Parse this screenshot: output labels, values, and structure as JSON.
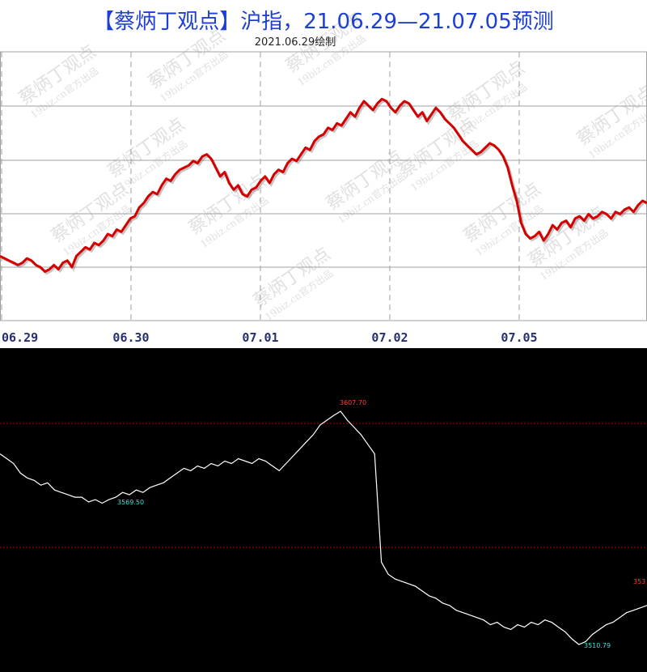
{
  "top_chart": {
    "title": "【蔡炳丁观点】沪指，21.06.29—21.07.05预测",
    "subtitle": "2021.06.29绘制",
    "watermark_text": "蔡炳丁观点",
    "watermark_sub": "19biz.cn官方出品",
    "colors": {
      "line": "#d40000",
      "grid": "#a0a0a0",
      "title": "#1d3fd6",
      "tick": "#26306e"
    }
  },
  "bottom_chart": {
    "high_label": "3607.70",
    "low1_label": "3569.50",
    "low2_label": "3510.79",
    "right_label": "353",
    "colors": {
      "line": "#ffffff",
      "high": "#ff4040",
      "low": "#40e0e0",
      "ref_line": "#b00000"
    }
  },
  "chart_data": [
    {
      "type": "line",
      "title": "【蔡炳丁观点】沪指，21.06.29—21.07.05预测",
      "subtitle": "2021.06.29绘制",
      "categories": [
        "06.29",
        "06.30",
        "07.01",
        "07.02",
        "07.05"
      ],
      "series": [
        {
          "values": [
            30,
            29,
            28,
            27,
            26,
            27,
            29,
            28,
            26,
            25,
            23,
            24,
            26,
            24,
            27,
            28,
            25,
            30,
            32,
            34,
            33,
            36,
            35,
            37,
            40,
            39,
            42,
            41,
            44,
            47,
            48,
            52,
            54,
            57,
            59,
            58,
            62,
            65,
            64,
            67,
            69,
            70,
            71,
            73,
            72,
            75,
            76,
            74,
            70,
            66,
            68,
            63,
            60,
            62,
            58,
            57,
            60,
            61,
            64,
            66,
            63,
            67,
            69,
            68,
            72,
            74,
            73,
            76,
            79,
            78,
            82,
            84,
            85,
            88,
            87,
            90,
            89,
            92,
            95,
            93,
            97,
            100,
            98,
            96,
            99,
            101,
            100,
            97,
            95,
            98,
            100,
            99,
            96,
            93,
            95,
            91,
            94,
            97,
            95,
            92,
            90,
            88,
            85,
            82,
            80,
            78,
            76,
            77,
            79,
            81,
            80,
            78,
            75,
            70,
            62,
            55,
            45,
            40,
            38,
            39,
            41,
            37,
            40,
            44,
            42,
            45,
            46,
            43,
            47,
            48,
            46,
            49,
            47,
            48,
            50,
            49,
            47,
            50,
            49,
            51,
            52,
            50,
            53,
            55,
            54
          ],
          "ylim": [
            0,
            110
          ]
        }
      ],
      "grid": true
    },
    {
      "type": "line",
      "annotations": [
        "3607.70",
        "3569.50",
        "3510.79",
        "353"
      ],
      "series": [
        {
          "values": [
            3590,
            3588,
            3586,
            3582,
            3580,
            3579,
            3577,
            3578,
            3575,
            3574,
            3573,
            3572,
            3572,
            3570,
            3571,
            3569.5,
            3571,
            3572,
            3574,
            3573,
            3575,
            3574,
            3576,
            3577,
            3578,
            3580,
            3582,
            3584,
            3583,
            3585,
            3584,
            3586,
            3585,
            3587,
            3586,
            3588,
            3587,
            3586,
            3588,
            3587,
            3585,
            3583,
            3586,
            3589,
            3592,
            3595,
            3598,
            3602,
            3604,
            3606,
            3607.7,
            3604,
            3601,
            3598,
            3594,
            3590,
            3545,
            3540,
            3538,
            3537,
            3536,
            3535,
            3533,
            3531,
            3530,
            3528,
            3527,
            3525,
            3524,
            3523,
            3522,
            3521,
            3519,
            3520,
            3518,
            3517,
            3519,
            3518,
            3520,
            3519,
            3521,
            3520,
            3518,
            3516,
            3513,
            3510.79,
            3512,
            3515,
            3517,
            3519,
            3520,
            3522,
            3524,
            3525,
            3526,
            3527
          ],
          "ylim": [
            3500,
            3615
          ]
        }
      ],
      "ref_lines": [
        3607.7,
        3569.5
      ]
    }
  ]
}
